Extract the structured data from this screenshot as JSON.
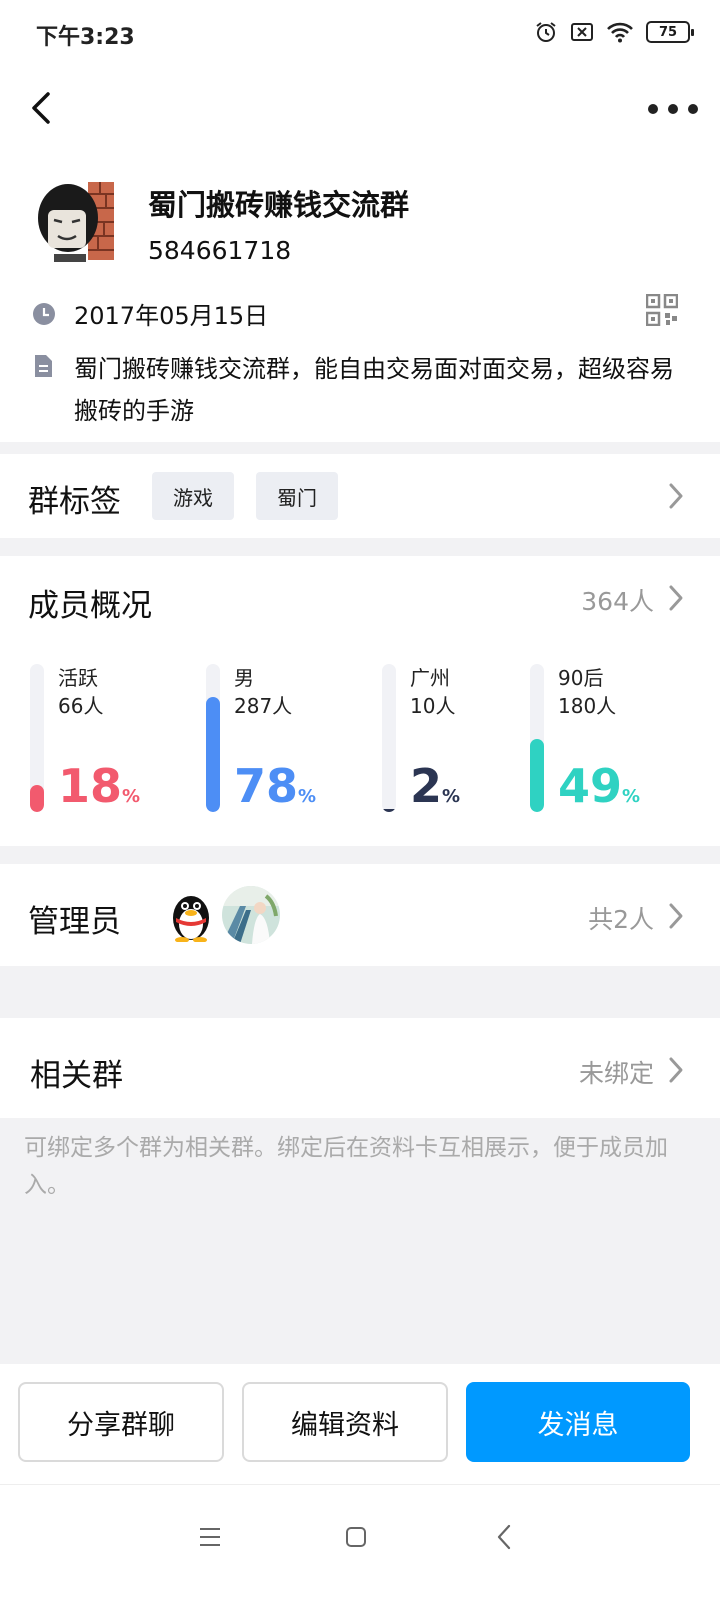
{
  "status_bar": {
    "time": "下午3:23",
    "battery": "75"
  },
  "group": {
    "name": "蜀门搬砖赚钱交流群",
    "id": "584661718",
    "created_date": "2017年05月15日",
    "description": "蜀门搬砖赚钱交流群，能自由交易面对面交易，超级容易搬砖的手游"
  },
  "tags_section": {
    "title": "群标签",
    "tags": [
      "游戏",
      "蜀门"
    ]
  },
  "members": {
    "title": "成员概况",
    "total": "364人",
    "stats": [
      {
        "label": "活跃",
        "count": "66人",
        "percent": 18,
        "unit": "%",
        "color": "#f25a6e"
      },
      {
        "label": "男",
        "count": "287人",
        "percent": 78,
        "unit": "%",
        "color": "#4d8ef5"
      },
      {
        "label": "广州",
        "count": "10人",
        "percent": 2,
        "unit": "%",
        "color": "#2b3552"
      },
      {
        "label": "90后",
        "count": "180人",
        "percent": 49,
        "unit": "%",
        "color": "#2fd2c2"
      }
    ]
  },
  "admins": {
    "title": "管理员",
    "count": "共2人"
  },
  "related": {
    "title": "相关群",
    "status": "未绑定",
    "hint": "可绑定多个群为相关群。绑定后在资料卡互相展示，便于成员加入。"
  },
  "actions": {
    "share": "分享群聊",
    "edit": "编辑资料",
    "message": "发消息"
  },
  "colors": {
    "primary": "#0099ff",
    "muted": "#999999"
  }
}
